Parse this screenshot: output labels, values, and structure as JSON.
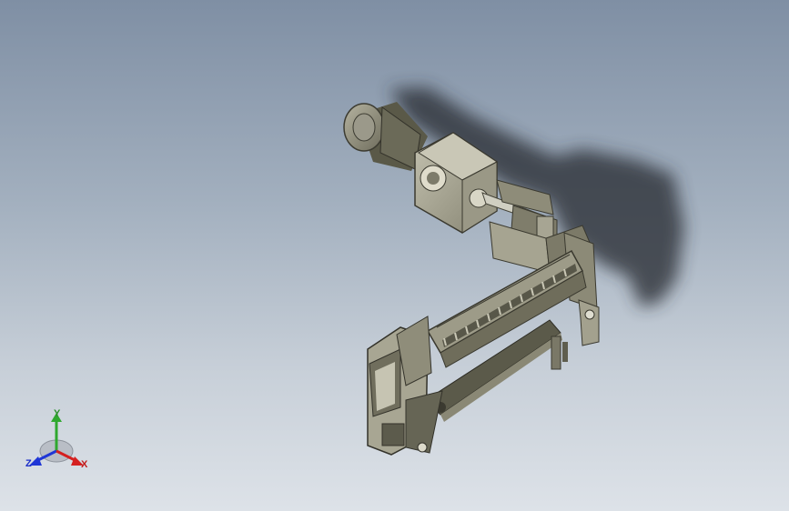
{
  "viewport": {
    "background_top": "#7f8fa4",
    "background_bottom": "#dde2e8"
  },
  "model": {
    "icon": "cad-assembly-model",
    "body_color": "#8c8a76",
    "dark_color": "#4b4a3f",
    "shadow_color": "#2b2f35"
  },
  "triad": {
    "icon": "coordinate-triad-icon",
    "x_label": "X",
    "y_label": "Y",
    "z_label": "Z",
    "x_color": "#d42020",
    "y_color": "#2fa82f",
    "z_color": "#1f36d6"
  }
}
